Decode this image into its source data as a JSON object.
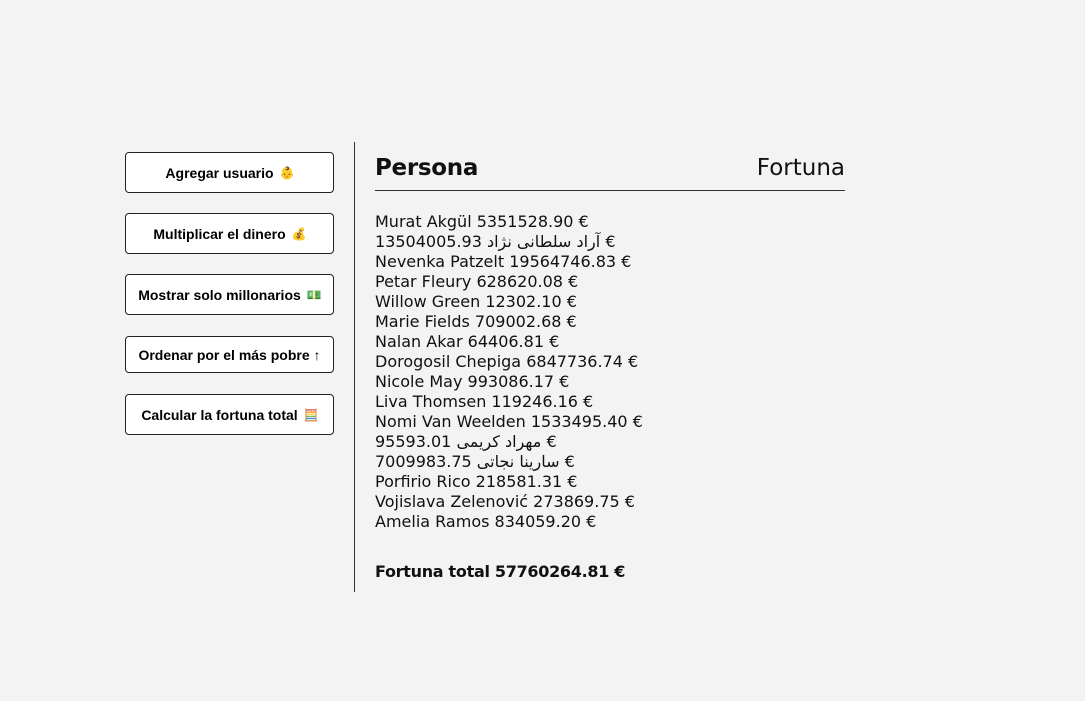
{
  "buttons": [
    {
      "label": "Agregar usuario",
      "icon": "👶"
    },
    {
      "label": "Multiplicar el dinero",
      "icon": "💰"
    },
    {
      "label": "Mostrar solo millonarios",
      "icon": "💵"
    },
    {
      "label": "Ordenar por el más pobre ↑",
      "icon": ""
    },
    {
      "label": "Calcular la fortuna total",
      "icon": "🧮"
    }
  ],
  "table": {
    "header_person": "Persona",
    "header_fortune": "Fortuna",
    "rows": [
      {
        "name": "Murat Akgül",
        "amount": "5351528.90 €"
      },
      {
        "name": "آراد سلطانی نژاد",
        "amount": "13504005.93 €",
        "rtl": true
      },
      {
        "name": "Nevenka Patzelt",
        "amount": "19564746.83 €"
      },
      {
        "name": "Petar Fleury",
        "amount": "628620.08 €"
      },
      {
        "name": "Willow Green",
        "amount": "12302.10 €"
      },
      {
        "name": "Marie Fields",
        "amount": "709002.68 €"
      },
      {
        "name": "Nalan Akar",
        "amount": "64406.81 €"
      },
      {
        "name": "Dorogosil Chepiga",
        "amount": "6847736.74 €"
      },
      {
        "name": "Nicole May",
        "amount": "993086.17 €"
      },
      {
        "name": "Liva Thomsen",
        "amount": "119246.16 €"
      },
      {
        "name": "Nomi Van Weelden",
        "amount": "1533495.40 €"
      },
      {
        "name": "مهراد کریمی",
        "amount": "95593.01 €",
        "rtl": true
      },
      {
        "name": "سارینا نجاتی",
        "amount": "7009983.75 €",
        "rtl": true
      },
      {
        "name": "Porfirio Rico",
        "amount": "218581.31 €"
      },
      {
        "name": "Vojislava Zelenović",
        "amount": "273869.75 €"
      },
      {
        "name": "Amelia Ramos",
        "amount": "834059.20 €"
      }
    ],
    "total_label": "Fortuna total",
    "total_value": "57760264.81 €"
  }
}
